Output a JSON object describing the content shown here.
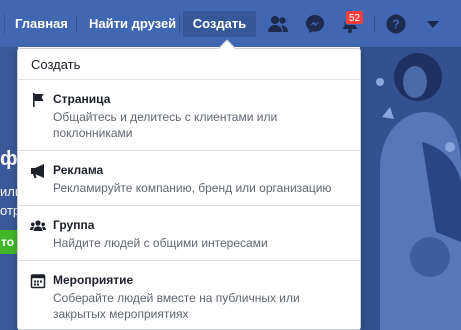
{
  "nav": {
    "home_label": "Главная",
    "find_friends_label": "Найти друзей",
    "create_label": "Создать",
    "notifications_count": "52",
    "icons": [
      "friend-requests-icon",
      "messenger-icon",
      "notifications-bell-icon",
      "help-icon",
      "account-menu-chevron-icon"
    ],
    "bar_color": "#4267b2"
  },
  "background": {
    "left_title_fragment": "фо",
    "left_line1_fragment": "или",
    "left_line2_fragment": "отр",
    "left_button_fragment": "то",
    "button_color": "#42b72a"
  },
  "dropdown": {
    "header": "Создать",
    "items": [
      {
        "icon": "flag-icon",
        "title": "Страница",
        "description": "Общайтесь и делитесь с клиентами или поклонниками"
      },
      {
        "icon": "megaphone-icon",
        "title": "Реклама",
        "description": "Рекламируйте компанию, бренд или организацию"
      },
      {
        "icon": "group-icon",
        "title": "Группа",
        "description": "Найдите людей с общими интересами"
      },
      {
        "icon": "calendar-icon",
        "title": "Мероприятие",
        "description": "Соберайте людей вместе на публичных или закрытых мероприятиях"
      }
    ]
  }
}
